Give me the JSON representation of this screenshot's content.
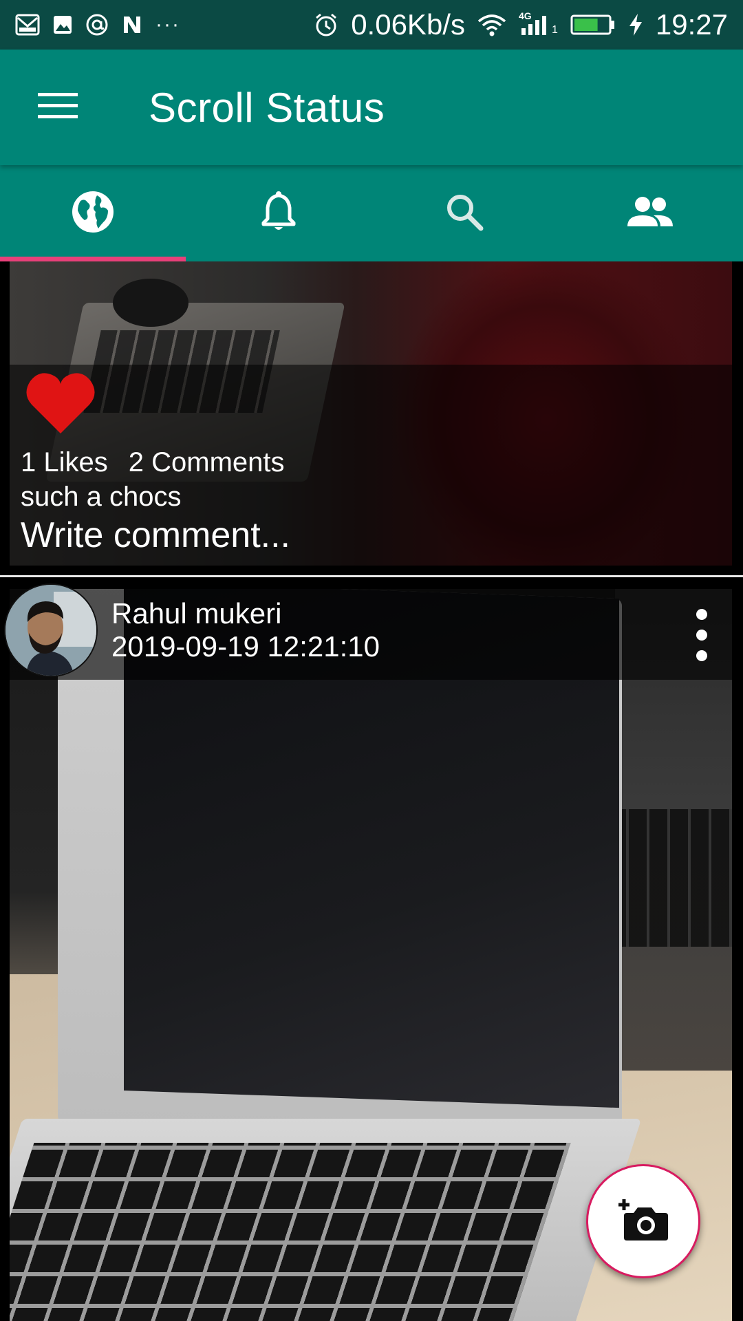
{
  "status_bar": {
    "network_speed": "0.06Kb/s",
    "network_type": "4G",
    "sim_slot": "1",
    "time": "19:27",
    "left_icons": [
      "mail-icon",
      "image-icon",
      "at-icon",
      "n-app-icon",
      "more-notifications-icon"
    ],
    "overflow": "···",
    "battery_level_pct": 70
  },
  "app_bar": {
    "title": "Scroll Status",
    "menu_icon": "hamburger-icon"
  },
  "tabs": [
    {
      "name": "world",
      "icon": "globe-icon",
      "active": true
    },
    {
      "name": "notifications",
      "icon": "bell-icon",
      "active": false
    },
    {
      "name": "search",
      "icon": "search-icon",
      "active": false
    },
    {
      "name": "people",
      "icon": "people-icon",
      "active": false
    }
  ],
  "posts": [
    {
      "likes_label": "1 Likes",
      "comments_label": "2 Comments",
      "caption": "such a chocs",
      "comment_prompt": "Write comment..."
    },
    {
      "author": "Rahul mukeri",
      "timestamp": "2019-09-19 12:21:10"
    }
  ],
  "fab": {
    "icon": "add-photo-icon"
  },
  "colors": {
    "primary": "#008577",
    "primary_dark": "#0b4a44",
    "accent": "#e8407a",
    "like_red": "#e01414"
  }
}
